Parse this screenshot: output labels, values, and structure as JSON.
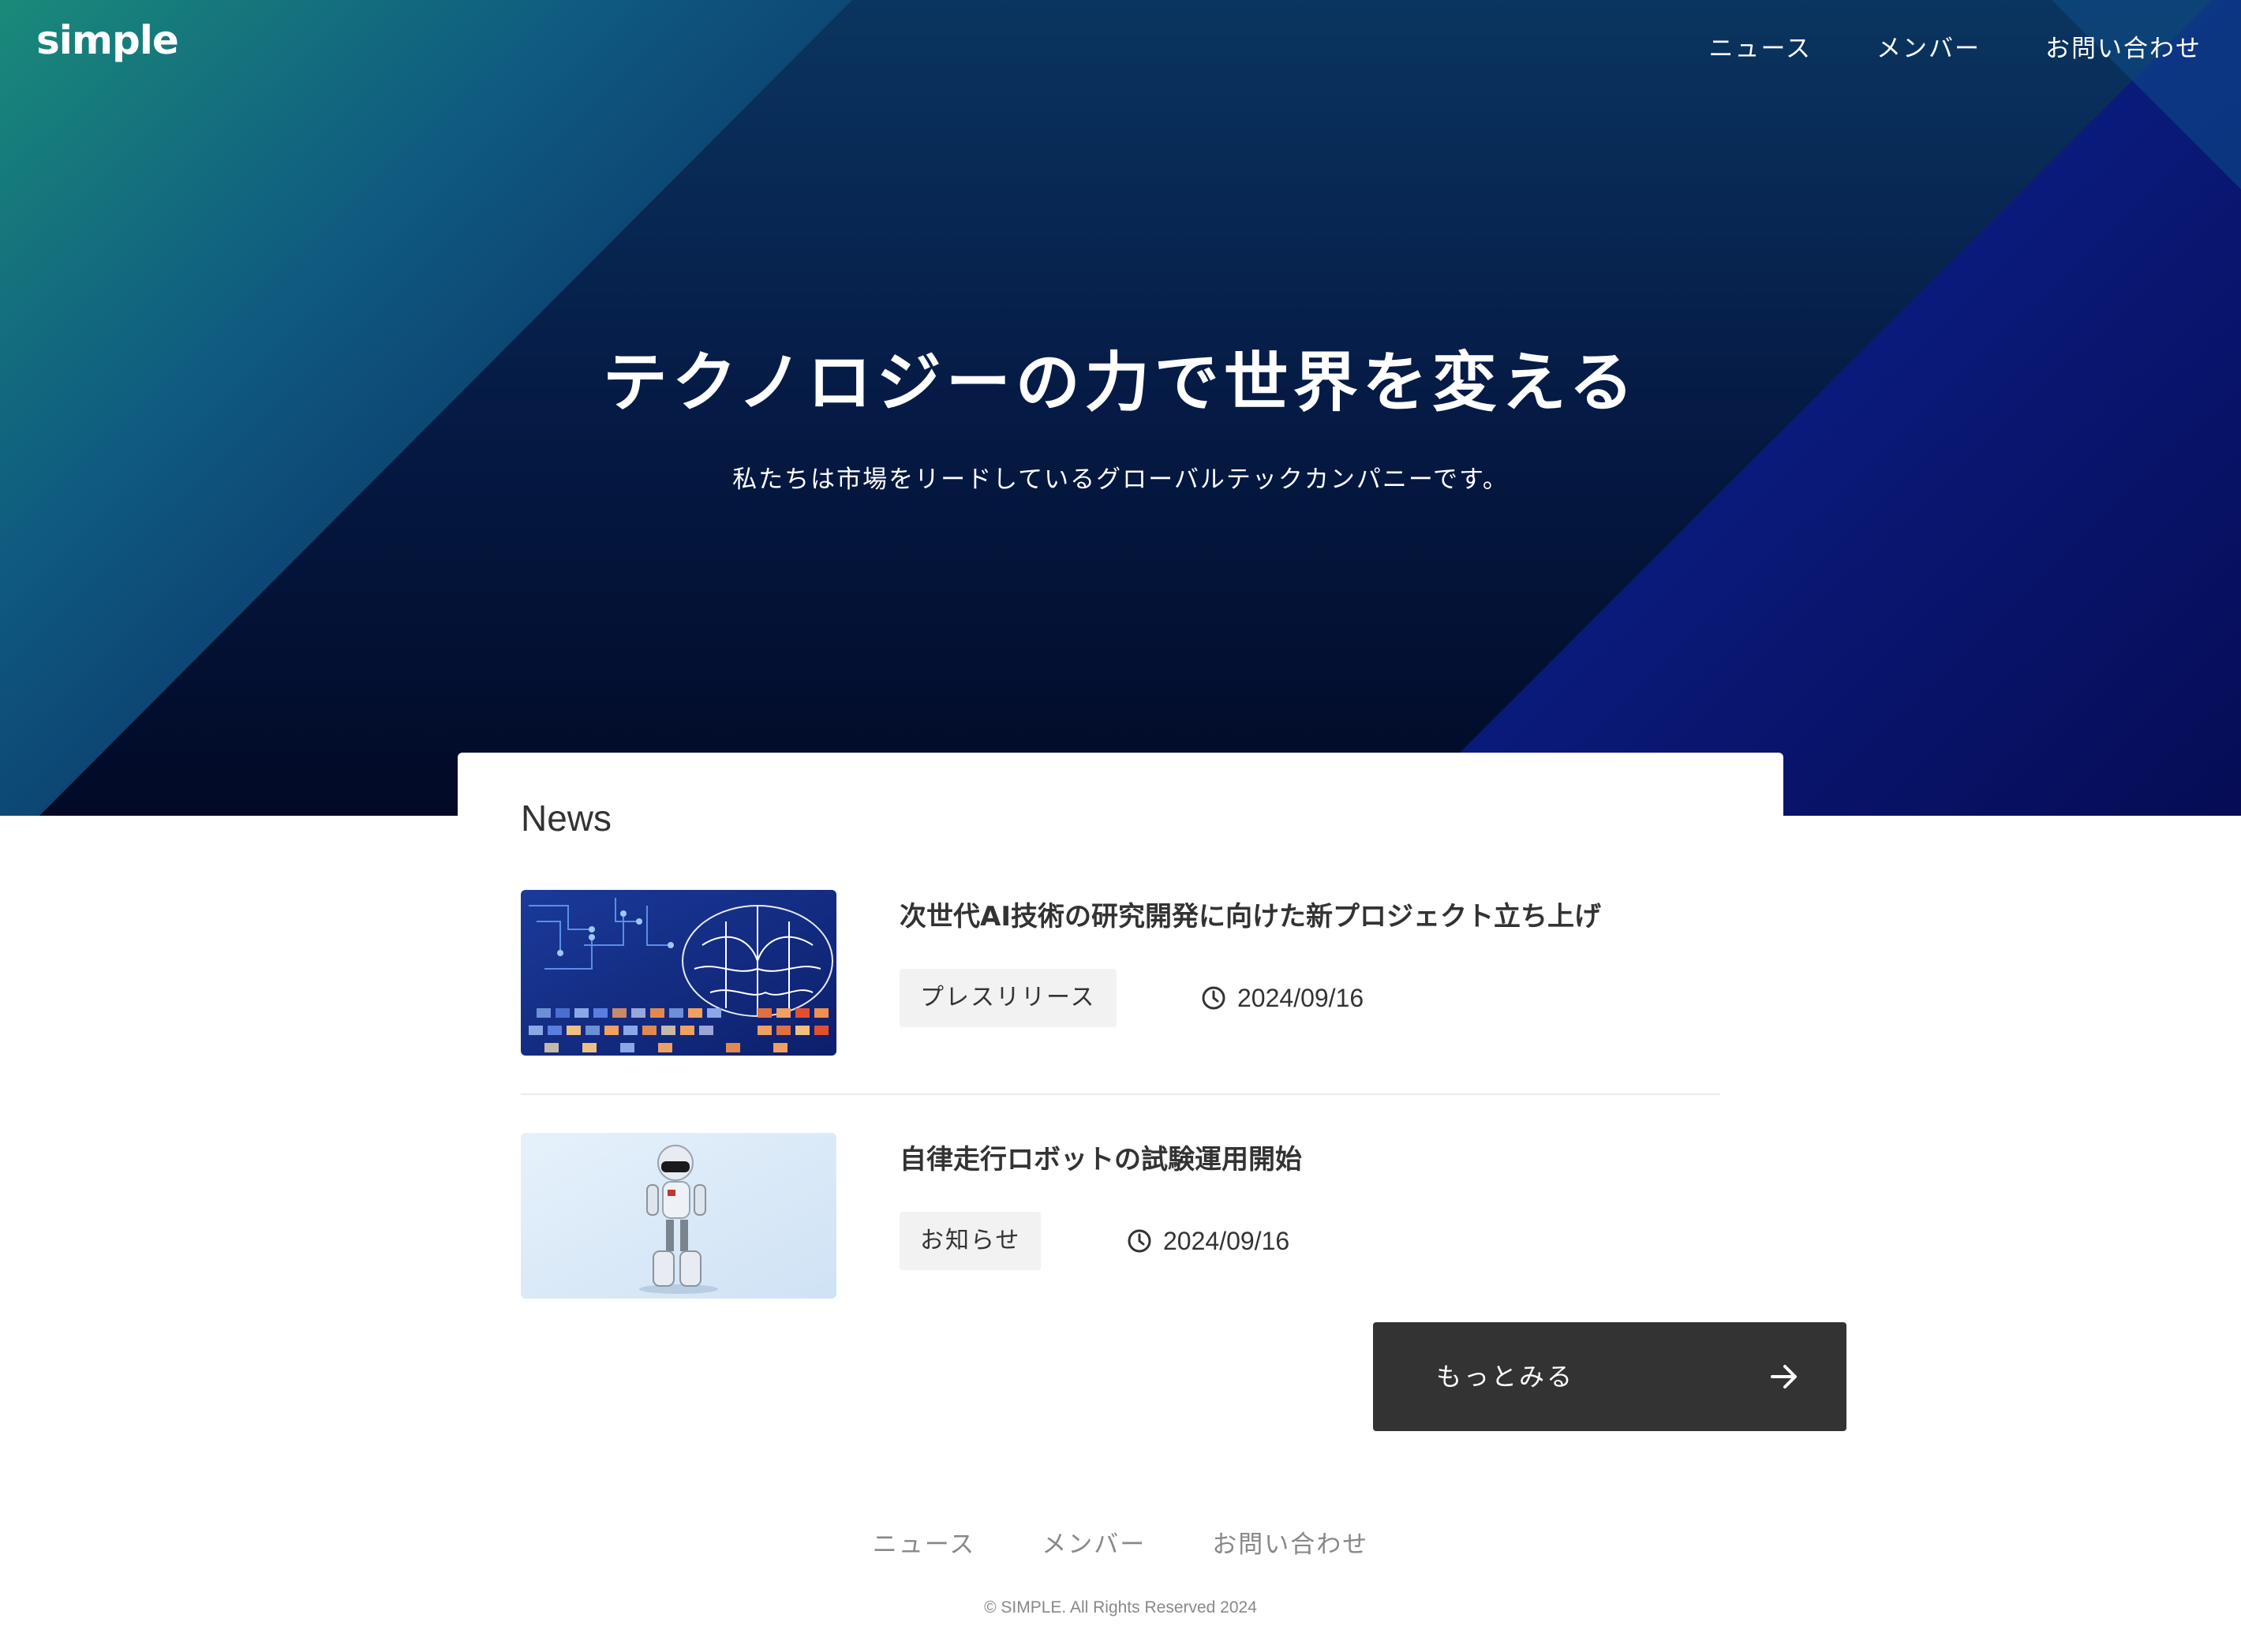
{
  "header": {
    "logo": "simple",
    "nav": [
      "ニュース",
      "メンバー",
      "お問い合わせ"
    ]
  },
  "hero": {
    "title": "テクノロジーの力で世界を変える",
    "subtitle": "私たちは市場をリードしているグローバルテックカンパニーです。"
  },
  "news": {
    "heading": "News",
    "items": [
      {
        "title": "次世代AI技術の研究開発に向けた新プロジェクト立ち上げ",
        "category": "プレスリリース",
        "date": "2024/09/16",
        "image": "ai-brain-circuit-image"
      },
      {
        "title": "自律走行ロボットの試験運用開始",
        "category": "お知らせ",
        "date": "2024/09/16",
        "image": "robot-image"
      }
    ],
    "more_label": "もっとみる"
  },
  "footer": {
    "nav": [
      "ニュース",
      "メンバー",
      "お問い合わせ"
    ],
    "copyright": "© SIMPLE. All Rights Reserved 2024"
  },
  "colors": {
    "hero_dark": "#030a26",
    "hero_teal": "#158a78",
    "hero_indigo": "#08107a",
    "button_bg": "#333333",
    "tag_bg": "#f2f2f2",
    "footer_text": "#888888"
  }
}
